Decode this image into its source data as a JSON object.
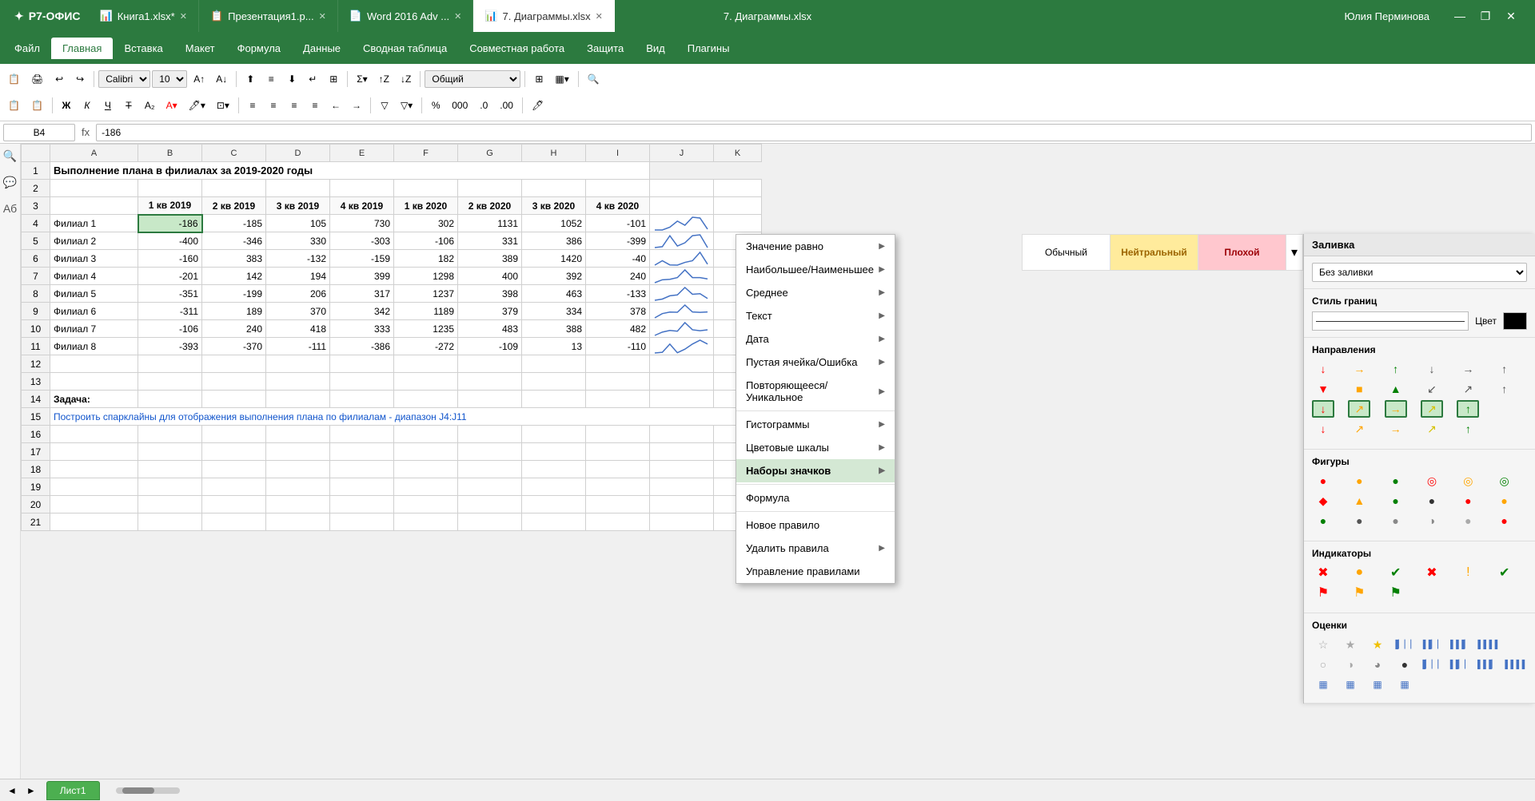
{
  "titlebar": {
    "logo": "Р7-ОФИС",
    "tabs": [
      {
        "label": "Книга1.xlsx*",
        "icon": "📊",
        "active": false,
        "closable": true
      },
      {
        "label": "Презентация1.р...",
        "icon": "📋",
        "active": false,
        "closable": true
      },
      {
        "label": "Word 2016 Adv ...",
        "icon": "📄",
        "active": false,
        "closable": true
      },
      {
        "label": "7. Диаграммы.xlsx",
        "icon": "📊",
        "active": true,
        "closable": true
      }
    ],
    "window_title": "7. Диаграммы.xlsx",
    "user": "Юлия Перминова",
    "controls": [
      "—",
      "❐",
      "✕"
    ]
  },
  "menubar": {
    "items": [
      "Файл",
      "Главная",
      "Вставка",
      "Макет",
      "Формула",
      "Данные",
      "Сводная таблица",
      "Совместная работа",
      "Защита",
      "Вид",
      "Плагины"
    ],
    "active": "Главная"
  },
  "formula_bar": {
    "cell_ref": "B4",
    "fx": "fx",
    "value": "-186"
  },
  "sheet": {
    "title": "7. Диаграммы.xlsx",
    "columns": [
      "",
      "A",
      "B",
      "C",
      "D",
      "E",
      "F",
      "G",
      "H",
      "I",
      "J",
      "K"
    ],
    "col_headers": [
      "1 кв 2019",
      "2 кв 2019",
      "3 кв 2019",
      "4 кв 2019",
      "1 кв 2020",
      "2 кв 2020",
      "3 кв 2020",
      "4 кв 2020"
    ],
    "header_row": "Выполнение плана в филиалах за 2019-2020 годы",
    "rows": [
      {
        "num": 1,
        "a": "Выполнение плана в филиалах за 2019-2020 годы",
        "b": "",
        "c": "",
        "d": "",
        "e": "",
        "f": "",
        "g": "",
        "h": "",
        "i": "",
        "j": "",
        "k": ""
      },
      {
        "num": 2,
        "a": "",
        "b": "",
        "c": "",
        "d": "",
        "e": "",
        "f": "",
        "g": "",
        "h": "",
        "i": "",
        "j": "",
        "k": ""
      },
      {
        "num": 3,
        "a": "",
        "b": "1 кв 2019",
        "c": "2 кв 2019",
        "d": "3 кв 2019",
        "e": "4 кв 2019",
        "f": "1 кв 2020",
        "g": "2 кв 2020",
        "h": "3 кв 2020",
        "i": "4 кв 2020",
        "j": "",
        "k": ""
      },
      {
        "num": 4,
        "a": "Филиал 1",
        "b": "-186",
        "c": "-185",
        "d": "105",
        "e": "730",
        "f": "302",
        "g": "1131",
        "h": "1052",
        "i": "-101",
        "j": "sparkline1",
        "k": ""
      },
      {
        "num": 5,
        "a": "Филиал 2",
        "b": "-400",
        "c": "-346",
        "d": "330",
        "e": "-303",
        "f": "-106",
        "g": "331",
        "h": "386",
        "i": "-399",
        "j": "sparkline2",
        "k": ""
      },
      {
        "num": 6,
        "a": "Филиал 3",
        "b": "-160",
        "c": "383",
        "d": "-132",
        "e": "-159",
        "f": "182",
        "g": "389",
        "h": "1420",
        "i": "-40",
        "j": "sparkline3",
        "k": ""
      },
      {
        "num": 7,
        "a": "Филиал 4",
        "b": "-201",
        "c": "142",
        "d": "194",
        "e": "399",
        "f": "1298",
        "g": "400",
        "h": "392",
        "i": "240",
        "j": "sparkline4",
        "k": ""
      },
      {
        "num": 8,
        "a": "Филиал 5",
        "b": "-351",
        "c": "-199",
        "d": "206",
        "e": "317",
        "f": "1237",
        "g": "398",
        "h": "463",
        "i": "-133",
        "j": "sparkline5",
        "k": ""
      },
      {
        "num": 9,
        "a": "Филиал 6",
        "b": "-311",
        "c": "189",
        "d": "370",
        "e": "342",
        "f": "1189",
        "g": "379",
        "h": "334",
        "i": "378",
        "j": "sparkline6",
        "k": ""
      },
      {
        "num": 10,
        "a": "Филиал 7",
        "b": "-106",
        "c": "240",
        "d": "418",
        "e": "333",
        "f": "1235",
        "g": "483",
        "h": "388",
        "i": "482",
        "j": "sparkline7",
        "k": ""
      },
      {
        "num": 11,
        "a": "Филиал 8",
        "b": "-393",
        "c": "-370",
        "d": "-111",
        "e": "-386",
        "f": "-272",
        "g": "-109",
        "h": "13",
        "i": "-110",
        "j": "sparkline8",
        "k": ""
      },
      {
        "num": 12,
        "a": "",
        "b": "",
        "c": "",
        "d": "",
        "e": "",
        "f": "",
        "g": "",
        "h": "",
        "i": "",
        "j": "",
        "k": ""
      },
      {
        "num": 13,
        "a": "",
        "b": "",
        "c": "",
        "d": "",
        "e": "",
        "f": "",
        "g": "",
        "h": "",
        "i": "",
        "j": "",
        "k": ""
      },
      {
        "num": 14,
        "a": "Задача:",
        "b": "",
        "c": "",
        "d": "",
        "e": "",
        "f": "",
        "g": "",
        "h": "",
        "i": "",
        "j": "",
        "k": ""
      },
      {
        "num": 15,
        "a": "Построить спарклайны для отображения выполнения плана по филиалам - диапазон J4:J11",
        "b": "",
        "c": "",
        "d": "",
        "e": "",
        "f": "",
        "g": "",
        "h": "",
        "i": "",
        "j": "",
        "k": ""
      },
      {
        "num": 16,
        "a": "",
        "b": "",
        "c": "",
        "d": "",
        "e": "",
        "f": "",
        "g": "",
        "h": "",
        "i": "",
        "j": "",
        "k": ""
      },
      {
        "num": 17,
        "a": "",
        "b": "",
        "c": "",
        "d": "",
        "e": "",
        "f": "",
        "g": "",
        "h": "",
        "i": "",
        "j": "",
        "k": ""
      },
      {
        "num": 18,
        "a": "",
        "b": "",
        "c": "",
        "d": "",
        "e": "",
        "f": "",
        "g": "",
        "h": "",
        "i": "",
        "j": "",
        "k": ""
      },
      {
        "num": 19,
        "a": "",
        "b": "",
        "c": "",
        "d": "",
        "e": "",
        "f": "",
        "g": "",
        "h": "",
        "i": "",
        "j": "",
        "k": ""
      },
      {
        "num": 20,
        "a": "",
        "b": "",
        "c": "",
        "d": "",
        "e": "",
        "f": "",
        "g": "",
        "h": "",
        "i": "",
        "j": "",
        "k": ""
      },
      {
        "num": 21,
        "a": "",
        "b": "",
        "c": "",
        "d": "",
        "e": "",
        "f": "",
        "g": "",
        "h": "",
        "i": "",
        "j": "",
        "k": ""
      }
    ]
  },
  "dropdown_menu": {
    "items": [
      {
        "label": "Значение равно",
        "has_arrow": true
      },
      {
        "label": "Наибольшее/Наименьшее",
        "has_arrow": true
      },
      {
        "label": "Среднее",
        "has_arrow": true
      },
      {
        "label": "Текст",
        "has_arrow": true
      },
      {
        "label": "Дата",
        "has_arrow": true
      },
      {
        "label": "Пустая ячейка/Ошибка",
        "has_arrow": true
      },
      {
        "label": "Повторяющееся/Уникальное",
        "has_arrow": true
      },
      {
        "sep": true
      },
      {
        "label": "Гистограммы",
        "has_arrow": true
      },
      {
        "label": "Цветовые шкалы",
        "has_arrow": true
      },
      {
        "label": "Наборы значков",
        "has_arrow": true,
        "active": true
      },
      {
        "sep": true
      },
      {
        "label": "Формула",
        "has_arrow": false
      },
      {
        "sep": true
      },
      {
        "label": "Новое правило",
        "has_arrow": false
      },
      {
        "label": "Удалить правила",
        "has_arrow": true
      },
      {
        "label": "Управление правилами",
        "has_arrow": false
      }
    ]
  },
  "right_panel": {
    "title": "Заливка",
    "fill_option": "Без заливки",
    "border_title": "Стиль границ",
    "color_label": "Цвет",
    "directions_title": "Направления",
    "directions": [
      {
        "icon": "↓",
        "color": "red"
      },
      {
        "icon": "→",
        "color": "orange"
      },
      {
        "icon": "↑",
        "color": "green"
      },
      {
        "icon": "↓",
        "color": "darkgray"
      },
      {
        "icon": "→",
        "color": "darkgray"
      },
      {
        "icon": "↑",
        "color": "darkgray"
      },
      {
        "icon": "▼",
        "color": "red"
      },
      {
        "icon": "■",
        "color": "orange"
      },
      {
        "icon": "▲",
        "color": "green"
      },
      {
        "icon": "↙",
        "color": "darkgray"
      },
      {
        "icon": "↗",
        "color": "darkgray"
      },
      {
        "icon": "↑",
        "color": "darkgray"
      },
      {
        "icon": "↓",
        "color": "red",
        "selected": true
      },
      {
        "icon": "↗",
        "color": "orange",
        "selected": true
      },
      {
        "icon": "→",
        "color": "orange",
        "selected": true
      },
      {
        "icon": "↗",
        "color": "yellow",
        "selected": true
      },
      {
        "icon": "↑",
        "color": "green",
        "selected": true
      },
      {
        "icon": "",
        "color": ""
      },
      {
        "icon": "↓",
        "color": "red"
      },
      {
        "icon": "↗",
        "color": "orange"
      },
      {
        "icon": "→",
        "color": "orange"
      },
      {
        "icon": "↗",
        "color": "yellow"
      },
      {
        "icon": "↑",
        "color": "green"
      },
      {
        "icon": "",
        "color": ""
      }
    ],
    "shapes_title": "Фигуры",
    "shapes": [
      {
        "icon": "●",
        "color": "red"
      },
      {
        "icon": "●",
        "color": "orange"
      },
      {
        "icon": "●",
        "color": "green"
      },
      {
        "icon": "◎",
        "color": "red"
      },
      {
        "icon": "◎",
        "color": "orange"
      },
      {
        "icon": "◎",
        "color": "green"
      },
      {
        "icon": "◆",
        "color": "red"
      },
      {
        "icon": "▲",
        "color": "orange"
      },
      {
        "icon": "●",
        "color": "green"
      },
      {
        "icon": "●",
        "color": "darkgray"
      },
      {
        "icon": "●",
        "color": "red"
      },
      {
        "icon": "●",
        "color": "orange"
      },
      {
        "icon": "●",
        "color": "green"
      },
      {
        "icon": "●",
        "color": "#555"
      },
      {
        "icon": "●",
        "color": "#888"
      },
      {
        "icon": "◑",
        "color": "#888"
      },
      {
        "icon": "●",
        "color": "#aaa"
      },
      {
        "icon": "●",
        "color": "red"
      }
    ],
    "indicators_title": "Индикаторы",
    "indicators": [
      {
        "icon": "✖",
        "color": "red"
      },
      {
        "icon": "●",
        "color": "orange"
      },
      {
        "icon": "✔",
        "color": "green"
      },
      {
        "icon": "✖",
        "color": "red"
      },
      {
        "icon": "!",
        "color": "orange"
      },
      {
        "icon": "✔",
        "color": "green"
      },
      {
        "icon": "⚑",
        "color": "red"
      },
      {
        "icon": "⚑",
        "color": "orange"
      },
      {
        "icon": "⚑",
        "color": "green"
      }
    ],
    "ratings_title": "Оценки",
    "ratings": [
      {
        "icon": "☆",
        "color": "#aaa"
      },
      {
        "icon": "★",
        "color": "#aaa"
      },
      {
        "icon": "★",
        "color": "#f0c000"
      },
      {
        "icon": "📊",
        "color": "#4472c4",
        "small": true
      },
      {
        "icon": "📊",
        "color": "#4472c4"
      },
      {
        "icon": "📊",
        "color": "#4472c4"
      },
      {
        "icon": "📊",
        "color": "#4472c4"
      },
      {
        "icon": "○",
        "color": "#aaa"
      },
      {
        "icon": "◑",
        "color": "#aaa"
      },
      {
        "icon": "◕",
        "color": "#888"
      },
      {
        "icon": "●",
        "color": "#333"
      },
      {
        "icon": "📊",
        "color": "#4472c4"
      },
      {
        "icon": "📊",
        "color": "#4472c4"
      },
      {
        "icon": "📊",
        "color": "#4472c4"
      },
      {
        "icon": "📊",
        "color": "#4472c4"
      },
      {
        "icon": "▦",
        "color": "#4472c4"
      },
      {
        "icon": "▦",
        "color": "#4472c4"
      },
      {
        "icon": "▦",
        "color": "#4472c4"
      },
      {
        "icon": "▦",
        "color": "#4472c4"
      }
    ]
  },
  "style_cells": [
    {
      "label": "Обычный",
      "style": "normal"
    },
    {
      "label": "Нейтральный",
      "style": "neutral"
    },
    {
      "label": "Плохой",
      "style": "bad"
    }
  ],
  "sheet_tab": "Лист1"
}
